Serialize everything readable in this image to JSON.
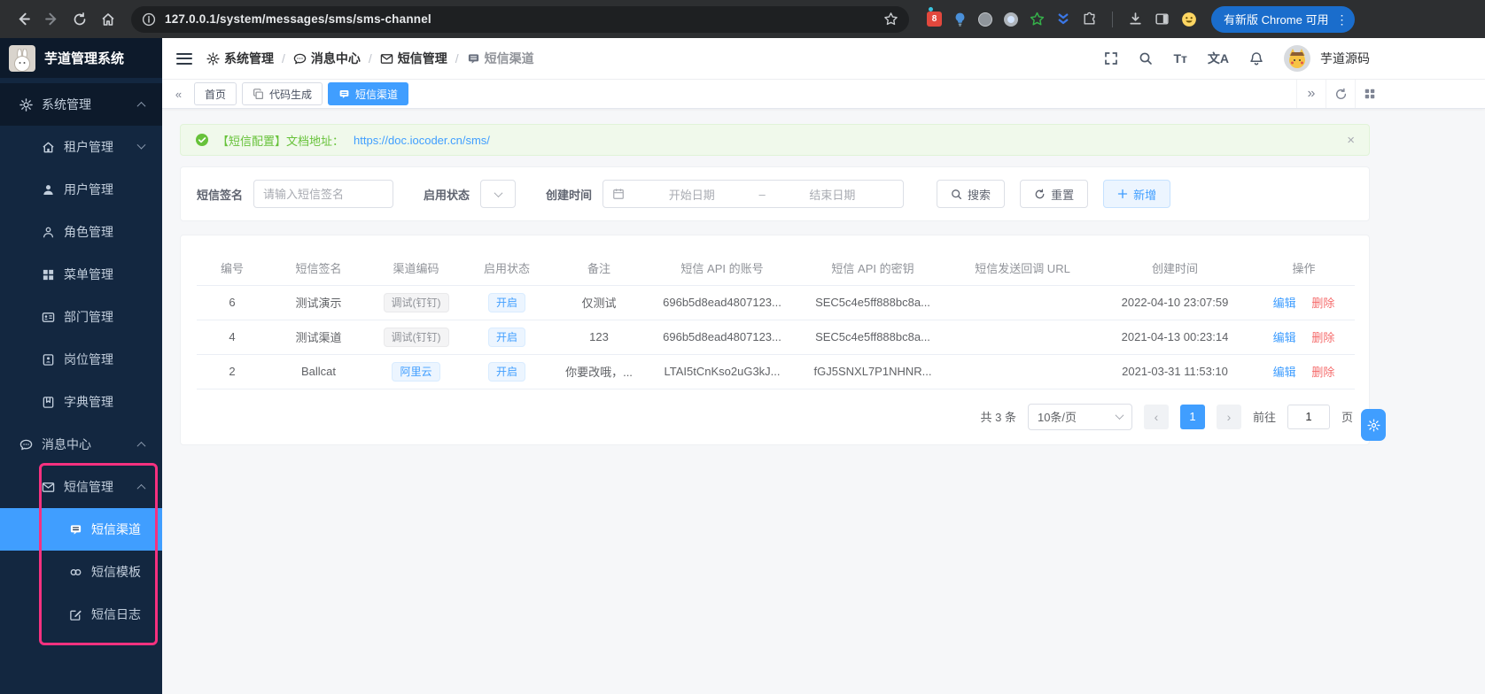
{
  "browser": {
    "url": "127.0.0.1/system/messages/sms/sms-channel",
    "update_button": "有新版 Chrome 可用"
  },
  "icons": {
    "close": "×",
    "breadcrumb_separator": "/",
    "more_vertical": "⋮",
    "extension_badge": "8",
    "font_size_glyph": "Tт",
    "language_glyph": "文A",
    "collapse_left": "«",
    "expand_right": "»",
    "prev_arrow": "‹",
    "next_arrow": "›"
  },
  "sidebar": {
    "app_title": "芋道管理系统",
    "items": [
      {
        "label": "系统管理"
      },
      {
        "label": "租户管理"
      },
      {
        "label": "用户管理"
      },
      {
        "label": "角色管理"
      },
      {
        "label": "菜单管理"
      },
      {
        "label": "部门管理"
      },
      {
        "label": "岗位管理"
      },
      {
        "label": "字典管理"
      },
      {
        "label": "消息中心"
      },
      {
        "label": "短信管理"
      },
      {
        "label": "短信渠道"
      },
      {
        "label": "短信模板"
      },
      {
        "label": "短信日志"
      }
    ]
  },
  "header": {
    "breadcrumb": [
      {
        "label": "系统管理"
      },
      {
        "label": "消息中心"
      },
      {
        "label": "短信管理"
      },
      {
        "label": "短信渠道"
      }
    ],
    "username": "芋道源码"
  },
  "tabs": [
    {
      "label": "首页"
    },
    {
      "label": "代码生成"
    },
    {
      "label": "短信渠道"
    }
  ],
  "alert": {
    "message": "【短信配置】文档地址：",
    "link": "https://doc.iocoder.cn/sms/"
  },
  "filters": {
    "signature_label": "短信签名",
    "signature_placeholder": "请输入短信签名",
    "status_label": "启用状态",
    "time_label": "创建时间",
    "start_placeholder": "开始日期",
    "range_separator": "–",
    "end_placeholder": "结束日期",
    "search_button": "搜索",
    "reset_button": "重置",
    "add_button": "新增"
  },
  "table": {
    "columns": [
      "编号",
      "短信签名",
      "渠道编码",
      "启用状态",
      "备注",
      "短信 API 的账号",
      "短信 API 的密钥",
      "短信发送回调 URL",
      "创建时间",
      "操作"
    ],
    "rows": [
      {
        "id": "6",
        "signature": "测试演示",
        "channel": "调试(钉钉)",
        "status": "开启",
        "remark": "仅测试",
        "account": "696b5d8ead4807123...",
        "secret": "SEC5c4e5ff888bc8a...",
        "callback": "",
        "created": "2022-04-10 23:07:59"
      },
      {
        "id": "4",
        "signature": "测试渠道",
        "channel": "调试(钉钉)",
        "status": "开启",
        "remark": "123",
        "account": "696b5d8ead4807123...",
        "secret": "SEC5c4e5ff888bc8a...",
        "callback": "",
        "created": "2021-04-13 00:23:14"
      },
      {
        "id": "2",
        "signature": "Ballcat",
        "channel": "阿里云",
        "status": "开启",
        "remark": "你要改哦，...",
        "account": "LTAI5tCnKso2uG3kJ...",
        "secret": "fGJ5SNXL7P1NHNR...",
        "callback": "",
        "created": "2021-03-31 11:53:10"
      }
    ],
    "actions": {
      "edit": "编辑",
      "delete": "删除"
    }
  },
  "pagination": {
    "total": "共 3 条",
    "page_size": "10条/页",
    "page": "1",
    "goto_label": "前往",
    "goto_value": "1",
    "page_unit": "页"
  },
  "colors": {
    "primary": "#409eff",
    "success": "#67c23a",
    "danger": "#f56c6c",
    "sidebar_bg": "#132740",
    "highlight_border": "#f5317f"
  }
}
